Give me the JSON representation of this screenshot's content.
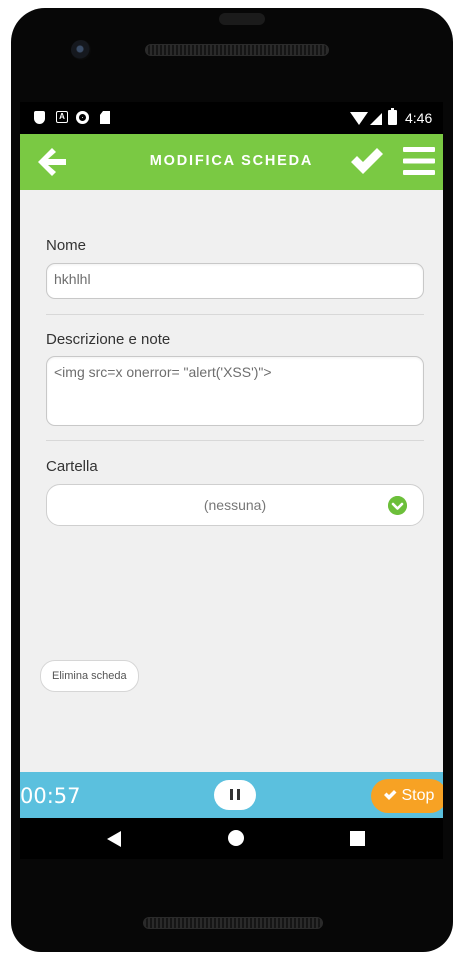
{
  "status_bar": {
    "time": "4:46",
    "left_icons": [
      "shield-icon",
      "a-notification-icon",
      "circle-notification-icon",
      "sd-card-icon"
    ],
    "right_icons": [
      "wifi-icon",
      "signal-icon",
      "battery-icon"
    ]
  },
  "app_bar": {
    "title": "MODIFICA SCHEDA",
    "color": "#7ac943"
  },
  "form": {
    "name_label": "Nome",
    "name_value": "hkhlhl",
    "description_label": "Descrizione e note",
    "description_value": "<img src=x onerror= \"alert('XSS')\">",
    "folder_label": "Cartella",
    "folder_value": "(nessuna)"
  },
  "delete_button": "Elimina scheda",
  "timer_bar": {
    "elapsed": "00:57",
    "stop_label": "Stop",
    "bar_color": "#5bc0de",
    "stop_color": "#f7a224"
  }
}
